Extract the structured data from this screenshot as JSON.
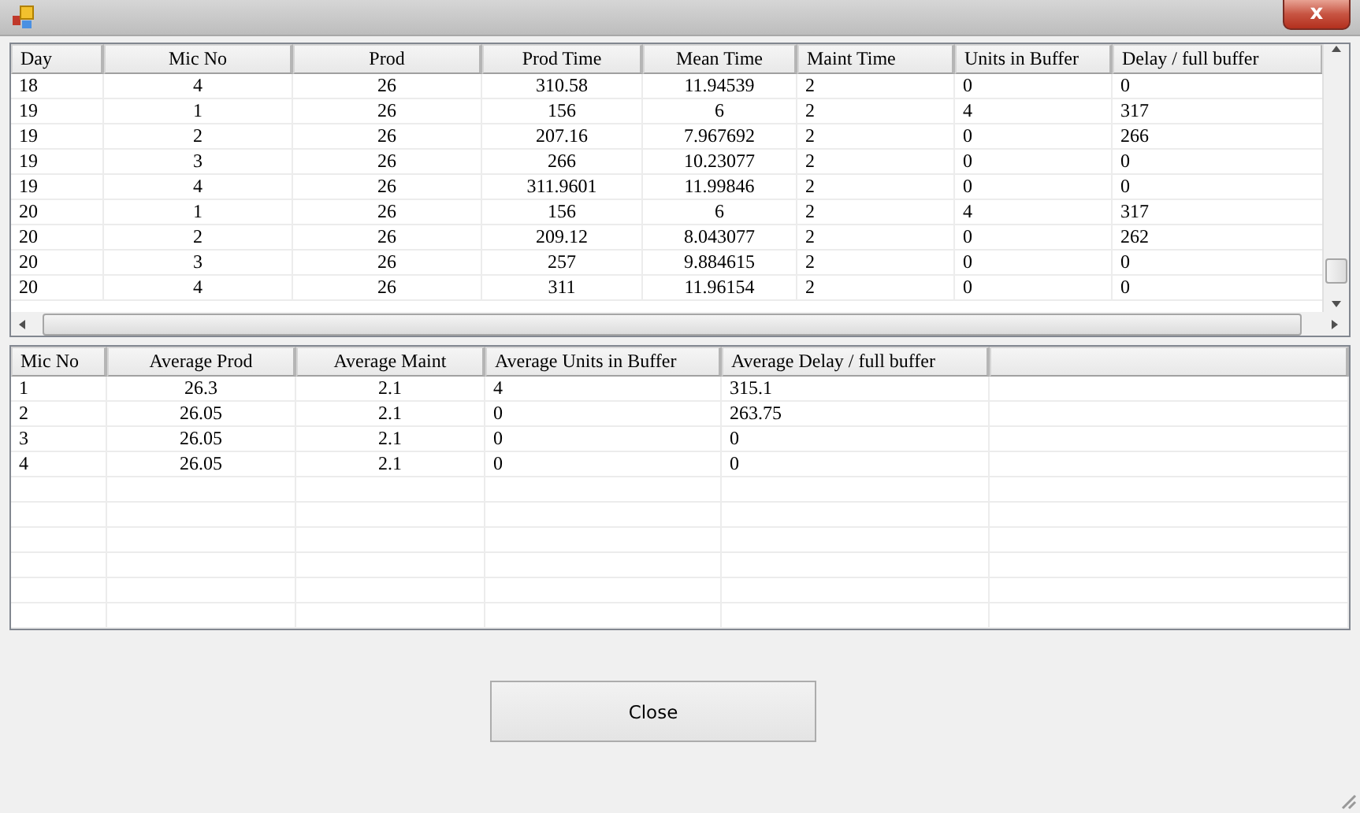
{
  "window": {
    "close_glyph": "x"
  },
  "top_table": {
    "columns": [
      "Day",
      "Mic No",
      "Prod",
      "Prod Time",
      "Mean Time",
      "Maint Time",
      "Units in Buffer",
      "Delay / full buffer"
    ],
    "rows": [
      [
        "18",
        "4",
        "26",
        "310.58",
        "11.94539",
        "2",
        "0",
        "0"
      ],
      [
        "19",
        "1",
        "26",
        "156",
        "6",
        "2",
        "4",
        "317"
      ],
      [
        "19",
        "2",
        "26",
        "207.16",
        "7.967692",
        "2",
        "0",
        "266"
      ],
      [
        "19",
        "3",
        "26",
        "266",
        "10.23077",
        "2",
        "0",
        "0"
      ],
      [
        "19",
        "4",
        "26",
        "311.9601",
        "11.99846",
        "2",
        "0",
        "0"
      ],
      [
        "20",
        "1",
        "26",
        "156",
        "6",
        "2",
        "4",
        "317"
      ],
      [
        "20",
        "2",
        "26",
        "209.12",
        "8.043077",
        "2",
        "0",
        "262"
      ],
      [
        "20",
        "3",
        "26",
        "257",
        "9.884615",
        "2",
        "0",
        "0"
      ],
      [
        "20",
        "4",
        "26",
        "311",
        "11.96154",
        "2",
        "0",
        "0"
      ]
    ]
  },
  "bottom_table": {
    "columns": [
      "Mic No",
      "Average Prod",
      "Average Maint",
      "Average Units in Buffer",
      "Average Delay / full buffer"
    ],
    "rows": [
      [
        "1",
        "26.3",
        "2.1",
        "4",
        "315.1"
      ],
      [
        "2",
        "26.05",
        "2.1",
        "0",
        "263.75"
      ],
      [
        "3",
        "26.05",
        "2.1",
        "0",
        "0"
      ],
      [
        "4",
        "26.05",
        "2.1",
        "0",
        "0"
      ]
    ]
  },
  "buttons": [
    {
      "label": "Close"
    }
  ]
}
